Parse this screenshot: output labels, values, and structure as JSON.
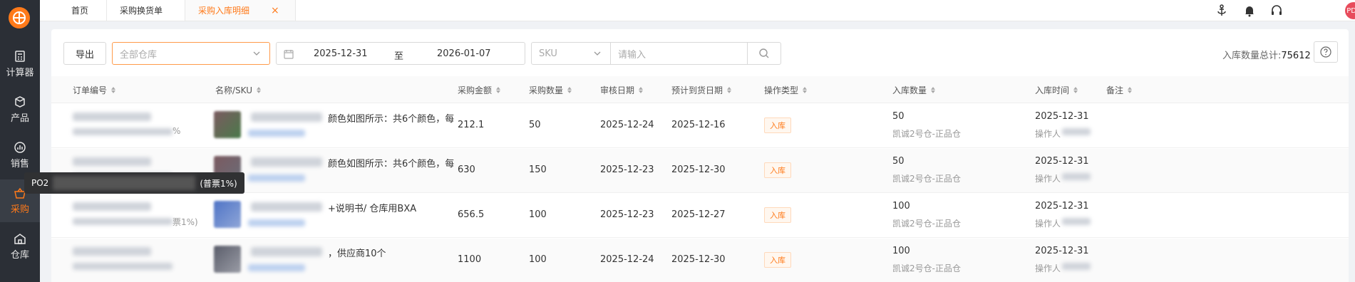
{
  "sidebar": {
    "items": [
      {
        "label": "计算器",
        "icon": "calculator-icon"
      },
      {
        "label": "产品",
        "icon": "box-icon"
      },
      {
        "label": "销售",
        "icon": "chart-icon"
      },
      {
        "label": "采购",
        "icon": "basket-icon",
        "active": true
      },
      {
        "label": "仓库",
        "icon": "warehouse-icon"
      }
    ]
  },
  "tabs": [
    {
      "label": "首页"
    },
    {
      "label": "采购换货单"
    },
    {
      "label": "采购入库明细",
      "active": true,
      "close": "×"
    }
  ],
  "avatar": {
    "text": "PDF"
  },
  "toolbar": {
    "export_label": "导出",
    "warehouse_placeholder": "全部仓库",
    "date_start": "2025-12-31",
    "date_sep": "至",
    "date_end": "2026-01-07",
    "sku_select": "SKU",
    "search_placeholder": "请输入",
    "total_label": "入库数量总计:",
    "total_value": "75612"
  },
  "table": {
    "headers": [
      "订单编号",
      "名称/SKU",
      "采购金额",
      "采购数量",
      "审核日期",
      "预计到货日期",
      "操作类型",
      "入库数量",
      "入库时间",
      "备注"
    ],
    "rows": [
      {
        "name_tail": "颜色如图所示：共6个颜色，每",
        "amount": "212.1",
        "qty": "50",
        "audit": "2025-12-24",
        "eta": "2025-12-16",
        "type": "入库",
        "in_qty": "50",
        "warehouse": "凯诚2号仓-正品仓",
        "time": "2025-12-31",
        "operator": "操作人"
      },
      {
        "name_tail": "颜色如图所示：共6个颜色，每",
        "amount": "630",
        "qty": "150",
        "audit": "2025-12-23",
        "eta": "2025-12-30",
        "type": "入库",
        "in_qty": "50",
        "warehouse": "凯诚2号仓-正品仓",
        "time": "2025-12-31",
        "operator": "操作人"
      },
      {
        "name_tail": "+说明书/ 仓库用BXA",
        "amount": "656.5",
        "qty": "100",
        "audit": "2025-12-23",
        "eta": "2025-12-27",
        "type": "入库",
        "in_qty": "100",
        "warehouse": "凯诚2号仓-正品仓",
        "time": "2025-12-31",
        "operator": "操作人"
      },
      {
        "name_tail": "，供应商10个",
        "amount": "1100",
        "qty": "100",
        "audit": "2025-12-24",
        "eta": "2025-12-30",
        "type": "入库",
        "in_qty": "100",
        "warehouse": "凯诚2号仓-正品仓",
        "time": "2025-12-31",
        "operator": "操作人"
      }
    ],
    "row_hints": [
      "%",
      "",
      "票1%)",
      ""
    ]
  },
  "tooltip": {
    "prefix": "PO2",
    "suffix": "(普票1%)"
  }
}
